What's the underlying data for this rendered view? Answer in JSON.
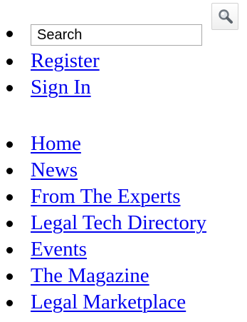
{
  "search": {
    "placeholder": "Search",
    "value": "",
    "button_icon": "magnifier-icon"
  },
  "user_menu": {
    "items": [
      {
        "label": "Register"
      },
      {
        "label": "Sign In"
      }
    ]
  },
  "nav_menu": {
    "items": [
      {
        "label": "Home"
      },
      {
        "label": "News"
      },
      {
        "label": "From The Experts"
      },
      {
        "label": "Legal Tech Directory"
      },
      {
        "label": "Events"
      },
      {
        "label": "The Magazine"
      },
      {
        "label": "Legal Marketplace"
      }
    ]
  },
  "colors": {
    "link": "#0000ee",
    "text": "#000000",
    "input_border": "#a8a8a8"
  }
}
